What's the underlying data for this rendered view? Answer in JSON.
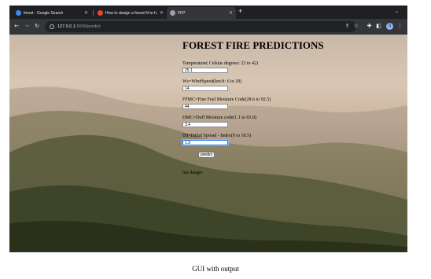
{
  "tabs": [
    {
      "title": "forest - Google Search",
      "favicon_color": "#4285f4",
      "active": false
    },
    {
      "title": "How to design a forest fit to h...",
      "favicon_color": "#ea4335",
      "active": false
    },
    {
      "title": "FFP",
      "favicon_color": "#9aa0a6",
      "active": true
    }
  ],
  "toolbar": {
    "url_host": "127.0.0.1",
    "url_path": ":5000/predict",
    "profile_initial": "S"
  },
  "icons": {
    "back": "back-arrow-icon",
    "forward": "forward-arrow-icon",
    "reload": "reload-icon",
    "site_info": "site-info-icon",
    "share": "share-icon",
    "bookmark": "star-icon",
    "extensions": "puzzle-icon",
    "side_panel": "side-panel-icon",
    "menu": "kebab-menu-icon",
    "new_tab": "plus-icon",
    "tab_search": "chevron-down-icon"
  },
  "page": {
    "title": "FOREST FIRE PREDICTIONS",
    "fields": [
      {
        "label": "Temperature( Celsius degrees: 22 to 42)",
        "value": "25.1"
      },
      {
        "label": "Ws=WindSpeed(km/h: 6 to 29)",
        "value": "14"
      },
      {
        "label": "FFMC=Fine Fuel Moisture Code(28.6 to 92.5)",
        "value": "44"
      },
      {
        "label": "DMC=Duff Moisture code(1.1 to 65.9)",
        "value": "3.4"
      },
      {
        "label": "ISI=Initial Spread - Index(0 to 18.5)",
        "value": "1.3"
      }
    ],
    "predict_label": "predict",
    "result_text": "not danger"
  },
  "caption": "GUI with output"
}
